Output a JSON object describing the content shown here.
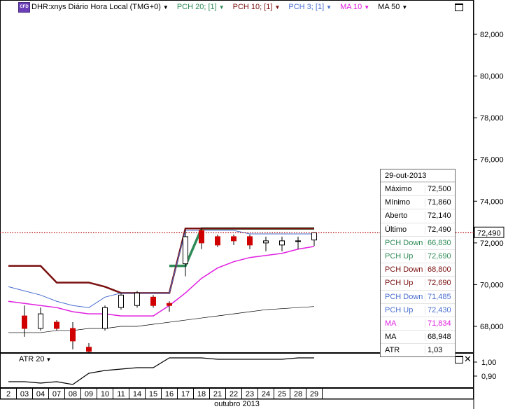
{
  "legend": {
    "symbol": "DHR:xnys Diário Hora Local (TMG+0)",
    "badge": "CFD",
    "items": [
      {
        "label": "PCH 20; [1]",
        "color": "#2e8b57"
      },
      {
        "label": "PCH 10; [1]",
        "color": "#7a1010"
      },
      {
        "label": "PCH 3; [1]",
        "color": "#4a6fd0"
      },
      {
        "label": "MA 10",
        "color": "#e020e0"
      },
      {
        "label": "MA 50",
        "color": "#000000"
      }
    ]
  },
  "price_axis": {
    "ticks": [
      "82,000",
      "80,000",
      "78,000",
      "76,000",
      "74,000",
      "72,000",
      "70,000",
      "68,000"
    ],
    "current": "72,490"
  },
  "atr_panel": {
    "label": "ATR 20",
    "ticks": [
      "1,00",
      "0,90"
    ]
  },
  "date_axis": {
    "days": [
      "2",
      "03",
      "04",
      "07",
      "08",
      "09",
      "10",
      "11",
      "14",
      "15",
      "16",
      "17",
      "18",
      "21",
      "22",
      "23",
      "24",
      "25",
      "28",
      "29"
    ],
    "month": "outubro 2013"
  },
  "info_panel": {
    "date": "29-out-2013",
    "rows": [
      {
        "k": "Máximo",
        "v": "72,500",
        "color": "#000000"
      },
      {
        "k": "Mínimo",
        "v": "71,860",
        "color": "#000000"
      },
      {
        "k": "Aberto",
        "v": "72,140",
        "color": "#000000"
      },
      {
        "k": "Último",
        "v": "72,490",
        "color": "#000000"
      },
      {
        "k": "PCH Down",
        "v": "66,830",
        "color": "#2e8b57"
      },
      {
        "k": "PCH Up",
        "v": "72,690",
        "color": "#2e8b57"
      },
      {
        "k": "PCH Down",
        "v": "68,800",
        "color": "#7a1010"
      },
      {
        "k": "PCH Up",
        "v": "72,690",
        "color": "#7a1010"
      },
      {
        "k": "PCH Down",
        "v": "71,485",
        "color": "#4a6fd0"
      },
      {
        "k": "PCH Up",
        "v": "72,430",
        "color": "#4a6fd0"
      },
      {
        "k": "MA",
        "v": "71,834",
        "color": "#e020e0"
      },
      {
        "k": "MA",
        "v": "68,948",
        "color": "#000000"
      },
      {
        "k": "ATR",
        "v": "1,03",
        "color": "#000000"
      }
    ]
  },
  "chart_data": {
    "type": "line",
    "title": "DHR:xnys Diário Hora Local (TMG+0)",
    "x": [
      "2",
      "03",
      "04",
      "07",
      "08",
      "09",
      "10",
      "11",
      "14",
      "15",
      "16",
      "17",
      "18",
      "21",
      "22",
      "23",
      "24",
      "25",
      "28",
      "29"
    ],
    "ylim": [
      67,
      83
    ],
    "candles": [
      {
        "o": 68.5,
        "h": 69.0,
        "l": 67.5,
        "c": 67.9,
        "dir": "down"
      },
      {
        "o": 67.9,
        "h": 68.9,
        "l": 67.8,
        "c": 68.6,
        "dir": "up"
      },
      {
        "o": 68.2,
        "h": 68.3,
        "l": 67.8,
        "c": 67.9,
        "dir": "down"
      },
      {
        "o": 67.9,
        "h": 68.2,
        "l": 66.9,
        "c": 67.3,
        "dir": "down"
      },
      {
        "o": 67.0,
        "h": 67.2,
        "l": 66.6,
        "c": 66.8,
        "dir": "down"
      },
      {
        "o": 67.9,
        "h": 69.0,
        "l": 67.8,
        "c": 68.9,
        "dir": "up"
      },
      {
        "o": 68.9,
        "h": 69.6,
        "l": 68.8,
        "c": 69.5,
        "dir": "up"
      },
      {
        "o": 69.0,
        "h": 69.7,
        "l": 68.9,
        "c": 69.6,
        "dir": "up"
      },
      {
        "o": 69.4,
        "h": 69.5,
        "l": 68.9,
        "c": 69.0,
        "dir": "down"
      },
      {
        "o": 69.1,
        "h": 69.2,
        "l": 68.7,
        "c": 69.0,
        "dir": "down"
      },
      {
        "o": 71.0,
        "h": 72.6,
        "l": 70.4,
        "c": 72.3,
        "dir": "up"
      },
      {
        "o": 72.6,
        "h": 72.7,
        "l": 71.7,
        "c": 72.0,
        "dir": "down"
      },
      {
        "o": 72.3,
        "h": 72.4,
        "l": 71.8,
        "c": 71.9,
        "dir": "down"
      },
      {
        "o": 72.3,
        "h": 72.4,
        "l": 71.9,
        "c": 72.1,
        "dir": "down"
      },
      {
        "o": 72.3,
        "h": 72.4,
        "l": 71.7,
        "c": 71.9,
        "dir": "down"
      },
      {
        "o": 72.0,
        "h": 72.3,
        "l": 71.6,
        "c": 72.1,
        "dir": "up"
      },
      {
        "o": 71.9,
        "h": 72.3,
        "l": 71.6,
        "c": 72.1,
        "dir": "up"
      },
      {
        "o": 72.1,
        "h": 72.3,
        "l": 71.7,
        "c": 72.1,
        "dir": "up"
      },
      {
        "o": 72.14,
        "h": 72.5,
        "l": 71.86,
        "c": 72.49,
        "dir": "up"
      }
    ],
    "series": [
      {
        "name": "PCH 20; [1]",
        "values": [
          null,
          null,
          null,
          null,
          null,
          null,
          null,
          null,
          null,
          null,
          70.9,
          70.9,
          72.69,
          72.69,
          72.69,
          72.69,
          72.69,
          72.69,
          72.69,
          72.69
        ]
      },
      {
        "name": "PCH 10; [1]",
        "values": [
          70.9,
          70.9,
          70.9,
          70.1,
          70.1,
          70.1,
          69.9,
          69.6,
          69.6,
          69.6,
          69.6,
          72.69,
          72.69,
          72.69,
          72.69,
          72.69,
          72.69,
          72.69,
          72.69,
          72.69
        ]
      },
      {
        "name": "PCH 3; [1]",
        "values": [
          69.9,
          69.7,
          69.5,
          69.2,
          69.0,
          68.9,
          69.4,
          69.6,
          69.6,
          69.6,
          69.6,
          72.6,
          72.6,
          72.6,
          72.6,
          72.43,
          72.43,
          72.43,
          72.43,
          72.43
        ]
      },
      {
        "name": "MA 10",
        "values": [
          69.2,
          69.1,
          69.0,
          68.9,
          68.7,
          68.6,
          68.6,
          68.5,
          68.5,
          68.5,
          69.0,
          69.6,
          70.3,
          70.8,
          71.1,
          71.3,
          71.4,
          71.5,
          71.7,
          71.83
        ]
      },
      {
        "name": "MA 50",
        "values": [
          67.7,
          67.7,
          67.7,
          67.8,
          67.8,
          67.9,
          67.9,
          68.0,
          68.0,
          68.1,
          68.2,
          68.3,
          68.4,
          68.5,
          68.6,
          68.7,
          68.8,
          68.85,
          68.9,
          68.95
        ]
      }
    ],
    "atr": {
      "name": "ATR 20",
      "ylim": [
        0.8,
        1.05
      ],
      "values": [
        0.86,
        0.86,
        0.85,
        0.86,
        0.84,
        0.92,
        0.94,
        0.95,
        0.96,
        0.96,
        1.03,
        1.03,
        1.03,
        1.02,
        1.02,
        1.02,
        1.02,
        1.02,
        1.03,
        1.03
      ]
    }
  }
}
